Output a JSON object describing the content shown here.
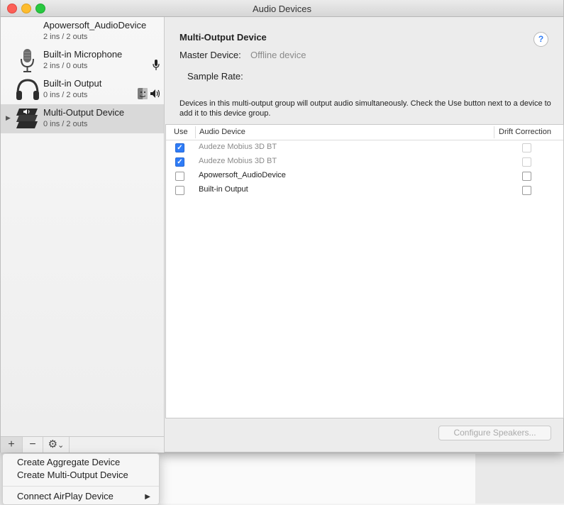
{
  "window": {
    "title": "Audio Devices"
  },
  "sidebar": {
    "devices": [
      {
        "name": "Apowersoft_AudioDevice",
        "io": "2 ins / 2 outs",
        "icon": "blank-device-icon"
      },
      {
        "name": "Built-in Microphone",
        "io": "2 ins / 0 outs",
        "icon": "microphone-icon"
      },
      {
        "name": "Built-in Output",
        "io": "0 ins / 2 outs",
        "icon": "headphones-icon"
      },
      {
        "name": "Multi-Output Device",
        "io": "0 ins / 2 outs",
        "icon": "multi-output-icon",
        "selected": true
      }
    ],
    "toolbar": {
      "add": "+",
      "remove": "−",
      "gear": "⚙",
      "gear_caret": "⌄"
    }
  },
  "detail": {
    "heading": "Multi-Output Device",
    "help": "?",
    "master_label": "Master Device:",
    "master_value": "Offline device",
    "sample_rate_label": "Sample Rate:",
    "description": "Devices in this multi-output group will output audio simultaneously. Check the Use button next to a device to add it to this device group.",
    "table": {
      "headers": [
        "Use",
        "Audio Device",
        "Drift Correction"
      ],
      "rows": [
        {
          "use": true,
          "device": "Audeze Mobius 3D BT",
          "drift": false,
          "dimmed": true
        },
        {
          "use": true,
          "device": "Audeze Mobius 3D BT",
          "drift": false,
          "dimmed": true
        },
        {
          "use": false,
          "device": "Apowersoft_AudioDevice",
          "drift": false,
          "dimmed": false
        },
        {
          "use": false,
          "device": "Built-in Output",
          "drift": false,
          "dimmed": false
        }
      ]
    },
    "configure_button": "Configure Speakers..."
  },
  "context_menu": {
    "items": [
      "Create Aggregate Device",
      "Create Multi-Output Device",
      "Connect AirPlay Device"
    ],
    "submenu_arrow": "▶"
  },
  "colors": {
    "accent": "#2f7cf6",
    "close": "#fc5f57",
    "minimize": "#fdbc2e",
    "maximize": "#28c840"
  }
}
